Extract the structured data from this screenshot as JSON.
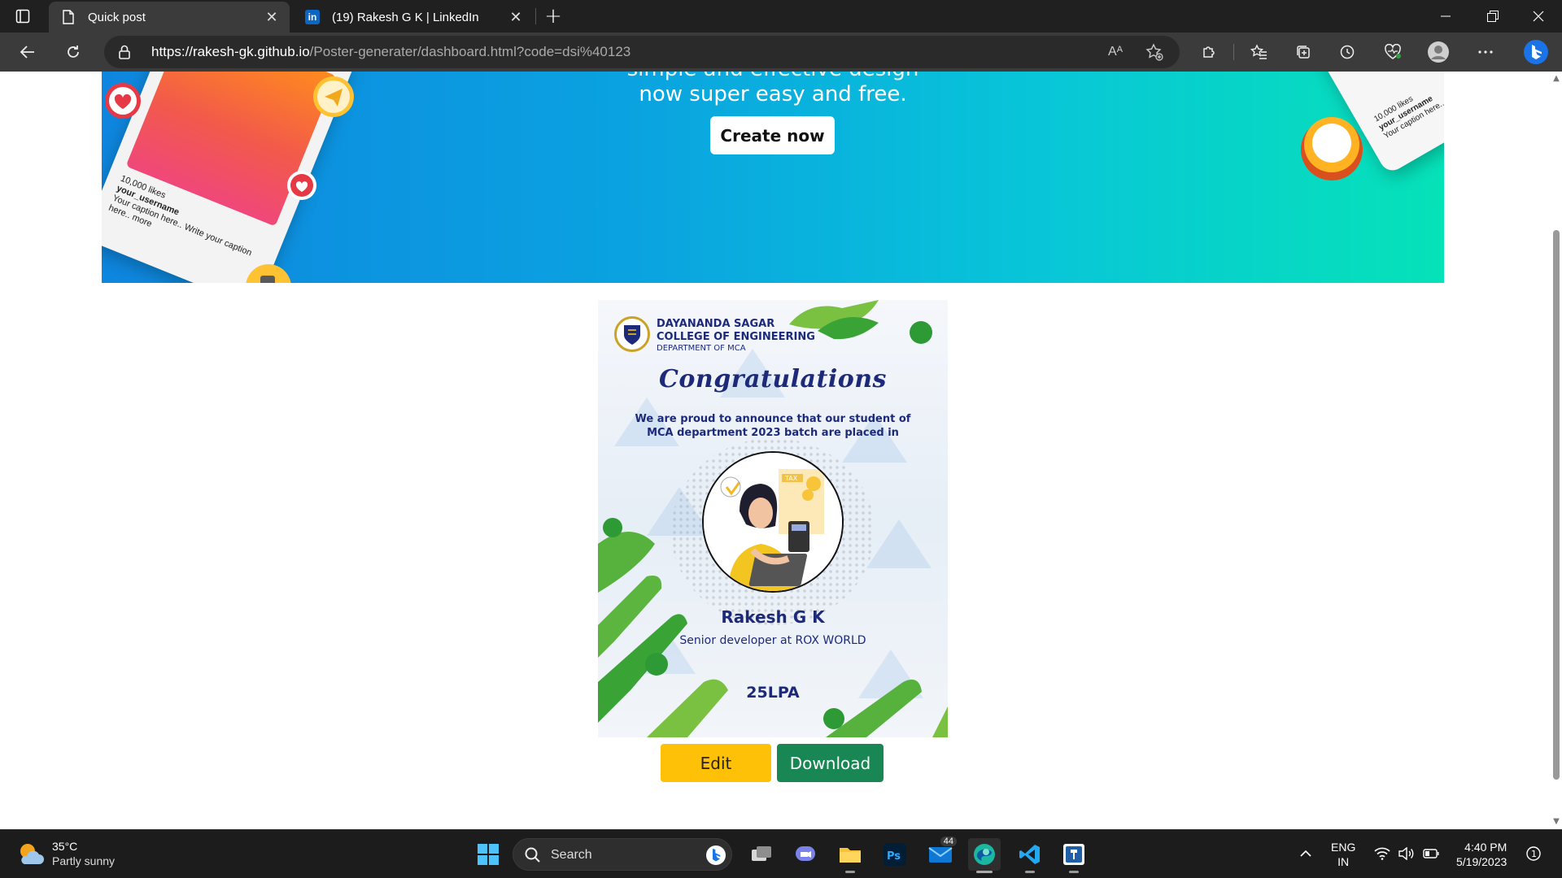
{
  "browser": {
    "tabs": [
      {
        "label": "Quick post",
        "active": true,
        "icon": "page-icon"
      },
      {
        "label": "(19) Rakesh G K | LinkedIn",
        "active": false,
        "icon": "linkedin-icon"
      }
    ],
    "url_host": "https://rakesh-gk.github.io",
    "url_path": "/Poster-generater/dashboard.html?code=dsi%40123",
    "read_aloud_label": "Aᴬ"
  },
  "banner": {
    "tagline_line1": "simple and effective design",
    "tagline_line2": "now super easy and free.",
    "create_button": "Create now",
    "mock_likes": "10,000 likes",
    "mock_user": "your_username",
    "mock_caption": "Your caption here.. Write your caption here.. more",
    "mock_caption_right": "Your caption here.. more"
  },
  "poster": {
    "college_line1": "DAYANANDA SAGAR",
    "college_line2": "COLLEGE OF ENGINEERING",
    "department": "DEPARTMENT OF MCA",
    "heading": "Congratulations",
    "announcement": "We are proud to announce that our student of MCA department 2023 batch are placed in",
    "photo_tag": "TAX",
    "student_name": "Rakesh G K",
    "role": "Senior developer at ROX WORLD",
    "package": "25LPA"
  },
  "actions": {
    "edit_label": "Edit",
    "download_label": "Download"
  },
  "taskbar": {
    "weather_temp": "35°C",
    "weather_desc": "Partly sunny",
    "search_label": "Search",
    "mail_badge": "44",
    "lang_line1": "ENG",
    "lang_line2": "IN",
    "time": "4:40 PM",
    "date": "5/19/2023",
    "notification_count": "1"
  },
  "colors": {
    "edit_button": "#ffc107",
    "download_button": "#198754",
    "poster_text": "#1d2a7a",
    "banner_start": "#0e86df",
    "banner_end": "#06e2b8"
  }
}
